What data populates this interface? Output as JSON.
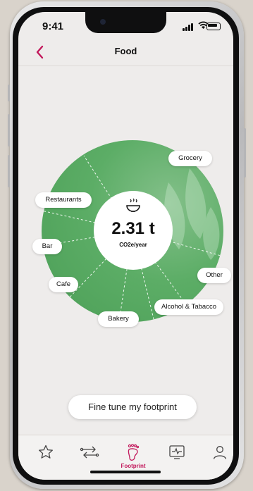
{
  "status_bar": {
    "time": "9:41"
  },
  "header": {
    "title": "Food",
    "back_icon": "chevron-left-icon"
  },
  "footprint": {
    "value": "2.31 t",
    "unit": "CO2e/year",
    "icon": "steaming-bowl-icon"
  },
  "categories": [
    {
      "label": "Grocery"
    },
    {
      "label": "Restaurants"
    },
    {
      "label": "Bar"
    },
    {
      "label": "Cafe"
    },
    {
      "label": "Bakery"
    },
    {
      "label": "Alcohol & Tabacco"
    },
    {
      "label": "Other"
    }
  ],
  "cta": {
    "label": "Fine tune my footprint"
  },
  "tabbar": {
    "items": [
      {
        "icon": "star-icon"
      },
      {
        "icon": "transactions-icon"
      },
      {
        "icon": "footprint-icon",
        "label": "Footprint",
        "active": true
      },
      {
        "icon": "activity-chart-icon"
      },
      {
        "icon": "profile-icon"
      }
    ]
  },
  "colors": {
    "accent": "#c2185b",
    "wheel_green": "#5cad66",
    "background": "#eeeceb"
  }
}
